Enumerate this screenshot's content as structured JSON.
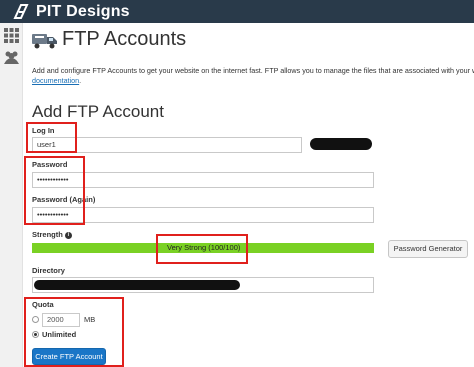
{
  "brand": {
    "name": "PIT Designs",
    "logo_icon": "pit-designs-logo"
  },
  "sidebar": {
    "icons": [
      "grid-icon",
      "users-icon"
    ]
  },
  "page": {
    "title": "FTP Accounts",
    "icon": "ftp-truck-icon",
    "description": "Add and configure FTP Accounts to get your website on the internet fast. FTP allows you to manage the files that are associated with your w",
    "description_link": "documentation",
    "description_end": "."
  },
  "form": {
    "section_title": "Add FTP Account",
    "login_label": "Log In",
    "login_value": "user1",
    "password_label": "Password",
    "password_value": "••••••••••••",
    "password_again_label": "Password (Again)",
    "password_again_value": "••••••••••••",
    "strength_label": "Strength",
    "strength_text": "Very Strong (100/100)",
    "strength_color": "#7ad124",
    "strength_level": 100,
    "password_generator_label": "Password Generator",
    "directory_label": "Directory",
    "quota_label": "Quota",
    "quota_value": "2000",
    "quota_unit": "MB",
    "unlimited_label": "Unlimited",
    "create_button_label": "Create FTP Account"
  },
  "colors": {
    "topbar": "#293a4a",
    "accent": "#1a76c7",
    "highlight": "#e0201c"
  }
}
